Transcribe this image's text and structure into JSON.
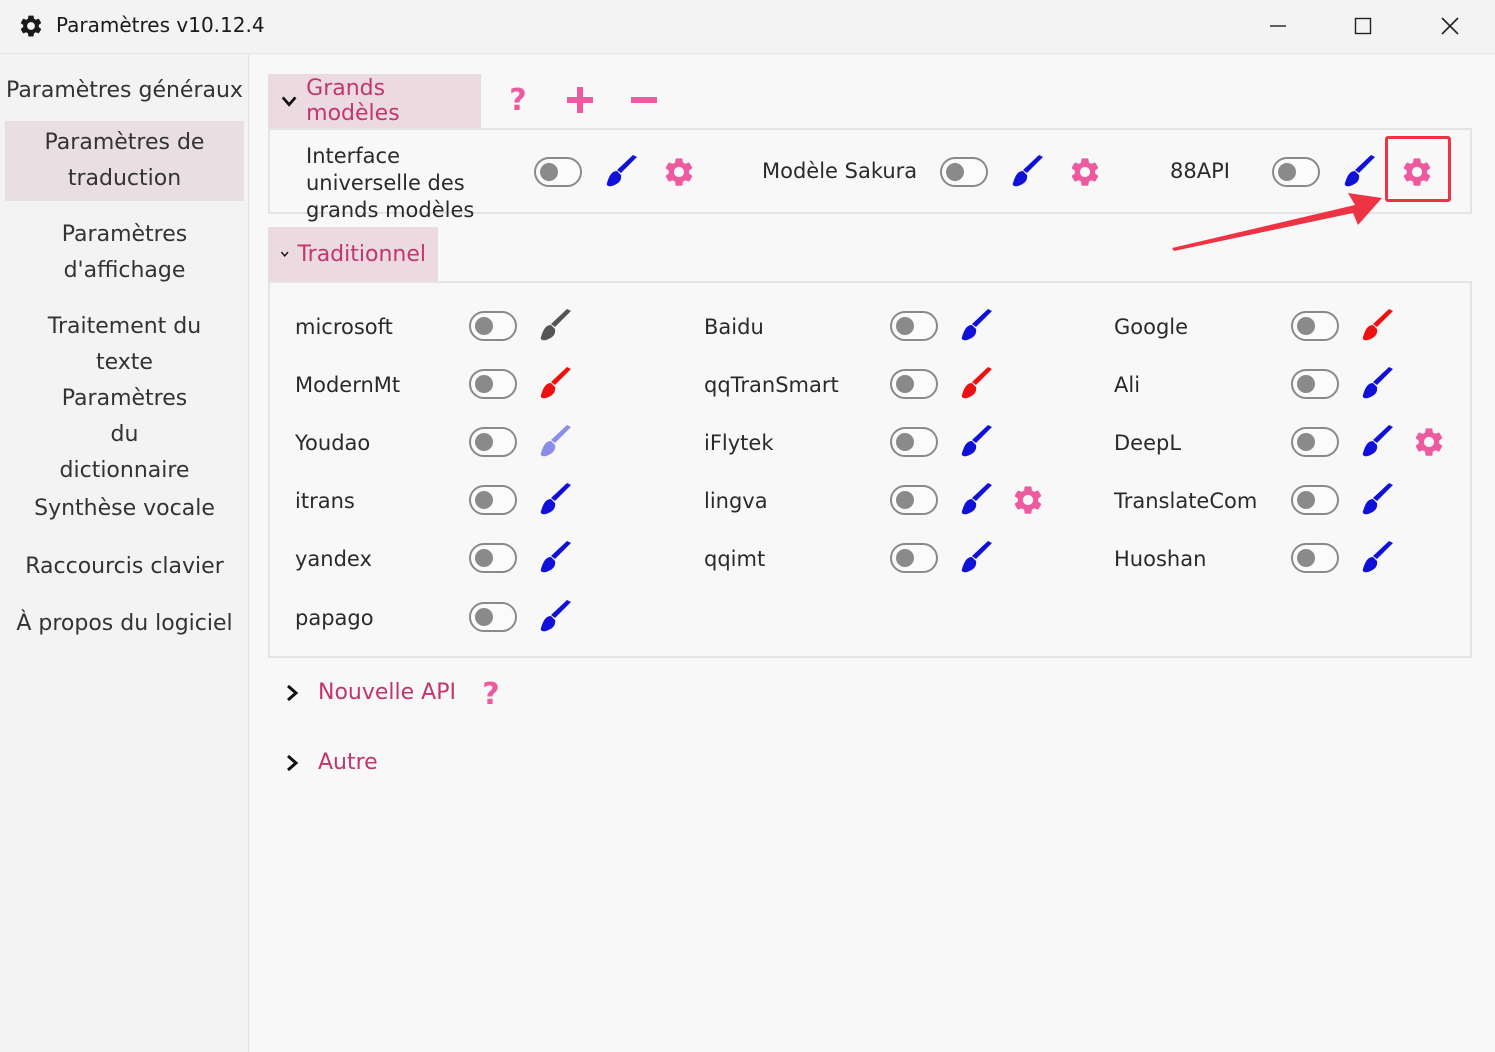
{
  "window": {
    "title": "Paramètres v10.12.4",
    "icon": "gear-icon"
  },
  "sidebar": {
    "items": [
      {
        "label": "Paramètres généraux",
        "active": false
      },
      {
        "label": "Paramètres de traduction",
        "active": true
      },
      {
        "label": "Paramètres d'affichage",
        "active": false
      },
      {
        "label": "Traitement du texte",
        "active": false
      },
      {
        "label": "Paramètres du dictionnaire",
        "active": false
      },
      {
        "label": "Synthèse vocale",
        "active": false
      },
      {
        "label": "Raccourcis clavier",
        "active": false
      },
      {
        "label": "À propos du logiciel",
        "active": false
      }
    ]
  },
  "llm_group": {
    "title": "Grands modèles",
    "expanded": true,
    "actions": [
      "help-icon",
      "add-icon",
      "remove-icon"
    ],
    "items": [
      {
        "label": "Interface universelle des grands modèles",
        "enabled": false,
        "brush_color": "#1010d8",
        "has_settings": true
      },
      {
        "label": "Modèle Sakura",
        "enabled": false,
        "brush_color": "#1010d8",
        "has_settings": true
      },
      {
        "label": "88API",
        "enabled": false,
        "brush_color": "#1010d8",
        "has_settings": true
      }
    ]
  },
  "traditional_group": {
    "title": "Traditionnel",
    "expanded": true,
    "items": [
      {
        "label": "microsoft",
        "enabled": false,
        "brush_color": "#555555",
        "has_settings": false
      },
      {
        "label": "Baidu",
        "enabled": false,
        "brush_color": "#1010d8",
        "has_settings": false
      },
      {
        "label": "Google",
        "enabled": false,
        "brush_color": "#ee1111",
        "has_settings": false
      },
      {
        "label": "ModernMt",
        "enabled": false,
        "brush_color": "#ee1111",
        "has_settings": false
      },
      {
        "label": "qqTranSmart",
        "enabled": false,
        "brush_color": "#ee1111",
        "has_settings": false
      },
      {
        "label": "Ali",
        "enabled": false,
        "brush_color": "#1010d8",
        "has_settings": false
      },
      {
        "label": "Youdao",
        "enabled": false,
        "brush_color": "#8c8cee",
        "has_settings": false
      },
      {
        "label": "iFlytek",
        "enabled": false,
        "brush_color": "#1010d8",
        "has_settings": false
      },
      {
        "label": "DeepL",
        "enabled": false,
        "brush_color": "#1010d8",
        "has_settings": true
      },
      {
        "label": "itrans",
        "enabled": false,
        "brush_color": "#1010d8",
        "has_settings": false
      },
      {
        "label": "lingva",
        "enabled": false,
        "brush_color": "#1010d8",
        "has_settings": true
      },
      {
        "label": "TranslateCom",
        "enabled": false,
        "brush_color": "#1010d8",
        "has_settings": false
      },
      {
        "label": "yandex",
        "enabled": false,
        "brush_color": "#1010d8",
        "has_settings": false
      },
      {
        "label": "qqimt",
        "enabled": false,
        "brush_color": "#1010d8",
        "has_settings": false
      },
      {
        "label": "Huoshan",
        "enabled": false,
        "brush_color": "#1010d8",
        "has_settings": false
      },
      {
        "label": "papago",
        "enabled": false,
        "brush_color": "#1010d8",
        "has_settings": false
      }
    ]
  },
  "new_api_group": {
    "title": "Nouvelle API",
    "expanded": false,
    "actions": [
      "help-icon"
    ]
  },
  "other_group": {
    "title": "Autre",
    "expanded": false
  },
  "colors": {
    "accent": "#c2356e",
    "icon_pink": "#ee5aa0",
    "highlight": "#ee3344",
    "active_bg": "#e9dfe2"
  }
}
